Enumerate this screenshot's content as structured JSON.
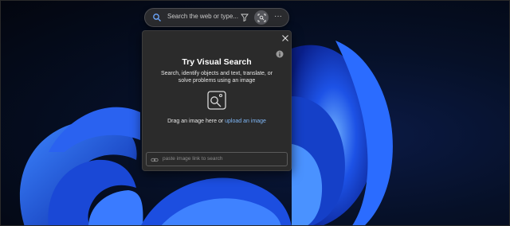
{
  "search_bar": {
    "placeholder": "Search the web or type...",
    "icons": [
      "search-icon",
      "filter-icon",
      "visual-search-icon",
      "more-icon"
    ],
    "more_glyph": "···"
  },
  "visual_search": {
    "title": "Try Visual Search",
    "description": "Search, identify objects and text, translate, or solve problems using an image",
    "drag_text": "Drag an image here or ",
    "upload_link": "upload an image",
    "link_placeholder": "paste image link to search",
    "icons": [
      "close-icon",
      "info-icon",
      "image-search-icon",
      "link-icon"
    ]
  },
  "colors": {
    "panel_bg": "#2b2b2b",
    "link": "#7fb6f5",
    "accent_blue": "#1f4fe0"
  }
}
